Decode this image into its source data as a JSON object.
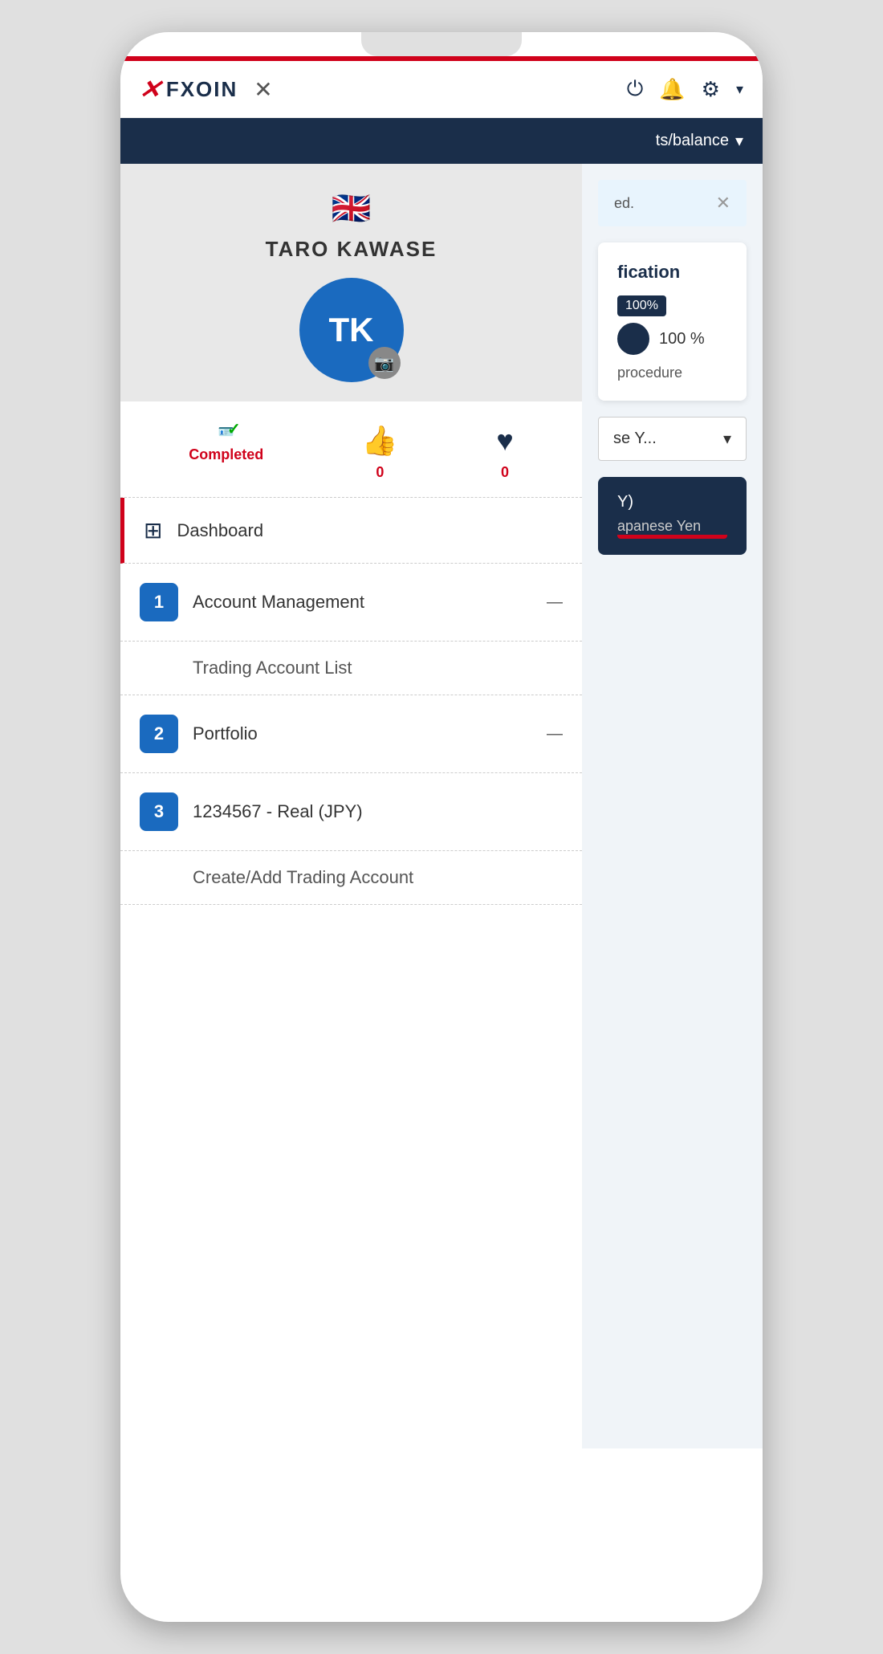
{
  "app": {
    "logo_x": "✕",
    "logo_text": "FXOIN",
    "close_label": "✕"
  },
  "header": {
    "power_icon": "⏻",
    "bell_icon": "🔔",
    "gear_icon": "⚙",
    "chevron": "▾",
    "nav_balance": "ts/balance",
    "nav_chevron": "▾"
  },
  "user": {
    "flag": "🇬🇧",
    "name": "TARO KAWASE",
    "initials": "TK",
    "camera_icon": "📷"
  },
  "stats": {
    "completed_label": "Completed",
    "likes_value": "0",
    "favorites_value": "0"
  },
  "nav": {
    "dashboard_label": "Dashboard",
    "dashboard_grid": "⊞",
    "account_mgmt_label": "Account Management",
    "account_mgmt_num": "1",
    "trading_account_list_label": "Trading Account List",
    "portfolio_label": "Portfolio",
    "portfolio_num": "2",
    "real_account_label": "1234567 - Real (JPY)",
    "real_account_num": "3",
    "create_account_label": "Create/Add Trading Account"
  },
  "right": {
    "notification_text": "ed.",
    "verification_title": "fication",
    "progress_badge": "100%",
    "progress_pct": "100 %",
    "procedure_text": "procedure",
    "select_text": "se Y...",
    "account_top": "Y)",
    "account_bottom": "apanese Yen"
  }
}
